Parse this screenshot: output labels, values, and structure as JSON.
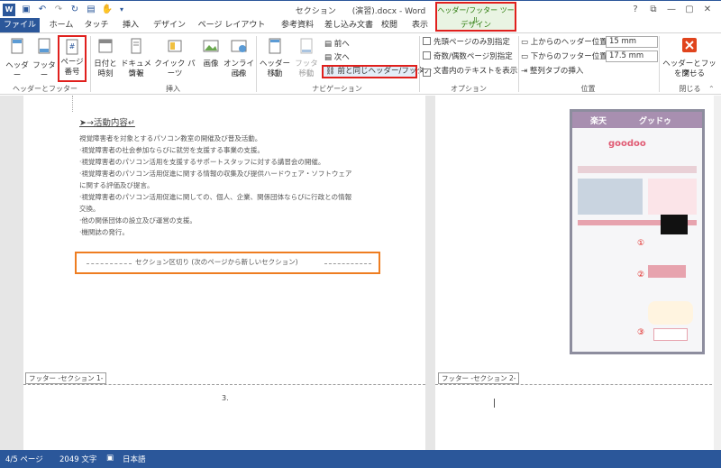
{
  "window": {
    "title": "セクション　　(演習).docx - Word"
  },
  "context_tab": {
    "group": "ヘッダー/フッター ツール",
    "tab": "デザイン"
  },
  "tabs": [
    "ファイル",
    "ホーム",
    "タッチ",
    "挿入",
    "デザイン",
    "ページ レイアウト",
    "参考資料",
    "差し込み文書",
    "校閲",
    "表示"
  ],
  "ribbon": {
    "hf_group": {
      "header": "ヘッダー",
      "footer": "フッター",
      "page_number_1": "ページ",
      "page_number_2": "番号",
      "label": "ヘッダーとフッター"
    },
    "insert_group": {
      "datetime_1": "日付と",
      "datetime_2": "時刻",
      "docinfo_1": "ドキュメント",
      "docinfo_2": "情報",
      "quickparts": "クイック パーツ",
      "picture": "画像",
      "online_1": "オンライン",
      "online_2": "画像",
      "label": "挿入"
    },
    "nav_group": {
      "goto_header_1": "ヘッダーに",
      "goto_header_2": "移動",
      "goto_footer_1": "フッターに",
      "goto_footer_2": "移動",
      "prev": "前へ",
      "next": "次へ",
      "link_previous": "前と同じヘッダー/フッター",
      "label": "ナビゲーション"
    },
    "options_group": {
      "first_page": "先頭ページのみ別指定",
      "odd_even": "奇数/偶数ページ別指定",
      "show_text": "文書内のテキストを表示",
      "label": "オプション"
    },
    "position_group": {
      "header_pos": "上からのヘッダー位置:",
      "header_val": "15 mm",
      "footer_pos": "下からのフッター位置:",
      "footer_val": "17.5 mm",
      "align_tab": "整列タブの挿入",
      "label": "位置"
    },
    "close_group": {
      "close_1": "ヘッダーとフッター",
      "close_2": "を閉じる",
      "label": "閉じる"
    }
  },
  "document": {
    "heading": "➤→活動内容↵",
    "lines": [
      "視覚障害者を対象とするパソコン教室の開催及び普及活動。",
      "·視覚障害者の社会参加ならびに就労を支援する事業の支援。",
      "·視覚障害者のパソコン活用を支援するサポートスタッフに対する講習会の開催。",
      "·視覚障害者のパソコン活用促進に関する情報の収集及び提供ハードウェア・ソフトウェア",
      "に関する評価及び提言。",
      "·視覚障害者のパソコン活用促進に関しての、個人、企業、関係団体ならびに行政との情報",
      "交換。",
      "·他の関係団体の設立及び運営の支援。",
      "·機関誌の発行。"
    ],
    "section_break": "セクション区切り (次のページから新しいセクション)",
    "footer_left": "フッター -セクション 1-",
    "footer_right": "フッター -セクション 2-",
    "page_number": "3.",
    "thumb_title": "楽天",
    "thumb_sub": "グッドゥ",
    "thumb_logo": "goodoo",
    "markers": [
      "①",
      "②",
      "③"
    ]
  },
  "status": {
    "page": "4/5 ページ",
    "words": "2049 文字",
    "lang": "日本語"
  },
  "colors": {
    "accent": "#2b579a",
    "highlight_red": "#e0201d",
    "highlight_orange": "#ee7d21",
    "context_green": "#2b7a0b"
  }
}
